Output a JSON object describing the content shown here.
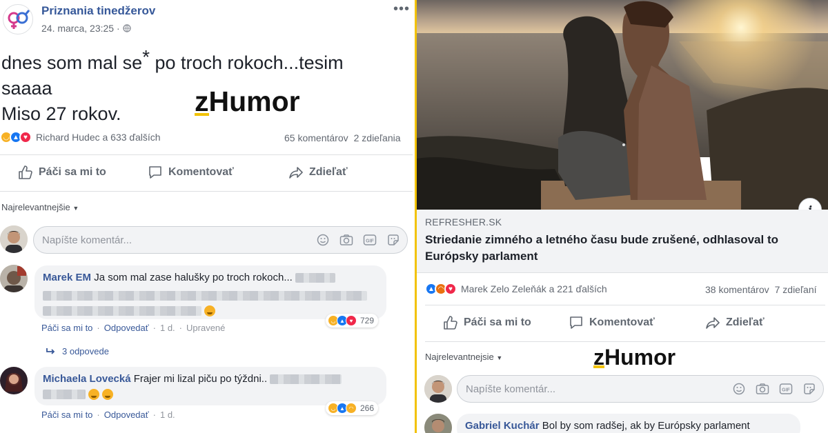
{
  "left_post": {
    "page_name": "Priznania tinedžerov",
    "timestamp": "24. marca, 23:25 ·",
    "post_line1_a": "dnes som mal se",
    "post_line1_ast": "*",
    "post_line1_b": " po troch rokoch...tesim",
    "post_line2": "saaaa",
    "post_line3": "Miso 27 rokov.",
    "watermark_z": "z",
    "watermark_rest": "Humor",
    "reactions_text": "Richard Hudec a 633 ďalších",
    "comments_count": "65 komentárov",
    "shares_count": "2 zdieľania",
    "actions": {
      "like": "Páči sa mi to",
      "comment": "Komentovať",
      "share": "Zdieľať"
    },
    "sort_label": "Najrelevantnejšie",
    "comment_placeholder": "Napíšte komentár...",
    "comments": [
      {
        "author": "Marek EM",
        "text": "Ja som mal zase halušky po troch rokoch...",
        "reaction_count": "729",
        "actions": {
          "like": "Páči sa mi to",
          "reply": "Odpovedať",
          "time": "1 d.",
          "edited": "Upravené"
        },
        "replies": "3 odpovede"
      },
      {
        "author": "Michaela Lovecká",
        "text": "Frajer mi lizal piču po týždni..",
        "reaction_count": "266",
        "actions": {
          "like": "Páči sa mi to",
          "reply": "Odpovedať",
          "time": "1 d."
        }
      }
    ]
  },
  "right_post": {
    "link_domain": "REFRESHER.SK",
    "link_title": "Striedanie zimného a letného času bude zrušené, odhlasoval to Európsky parlament",
    "info_icon": "i",
    "reactions_text": "Marek Zelo Zeleňák a 221 ďalších",
    "comments_count": "38 komentárov",
    "shares_count": "7 zdieľaní",
    "actions": {
      "like": "Páči sa mi to",
      "comment": "Komentovať",
      "share": "Zdieľať"
    },
    "sort_label": "Najrelevantnejsie",
    "watermark_z": "z",
    "watermark_rest": "Humor",
    "comment_placeholder": "Napíšte komentár...",
    "comments": [
      {
        "author": "Gabriel Kuchár",
        "text": "Bol by som radšej, ak by Európsky parlament"
      }
    ]
  },
  "icons": {
    "like": "thumbs-up-icon",
    "comment": "speech-bubble-icon",
    "share": "share-arrow-icon",
    "globe": "globe-icon",
    "more": "more-dots-icon",
    "emoji": "emoji-icon",
    "camera": "camera-icon",
    "gif": "gif-icon",
    "sticker": "sticker-icon"
  },
  "colors": {
    "divider": "#f2c200",
    "link_blue": "#365899",
    "like_blue": "#1877f2",
    "love_red": "#f0284a",
    "haha_yellow": "#f7b125"
  }
}
